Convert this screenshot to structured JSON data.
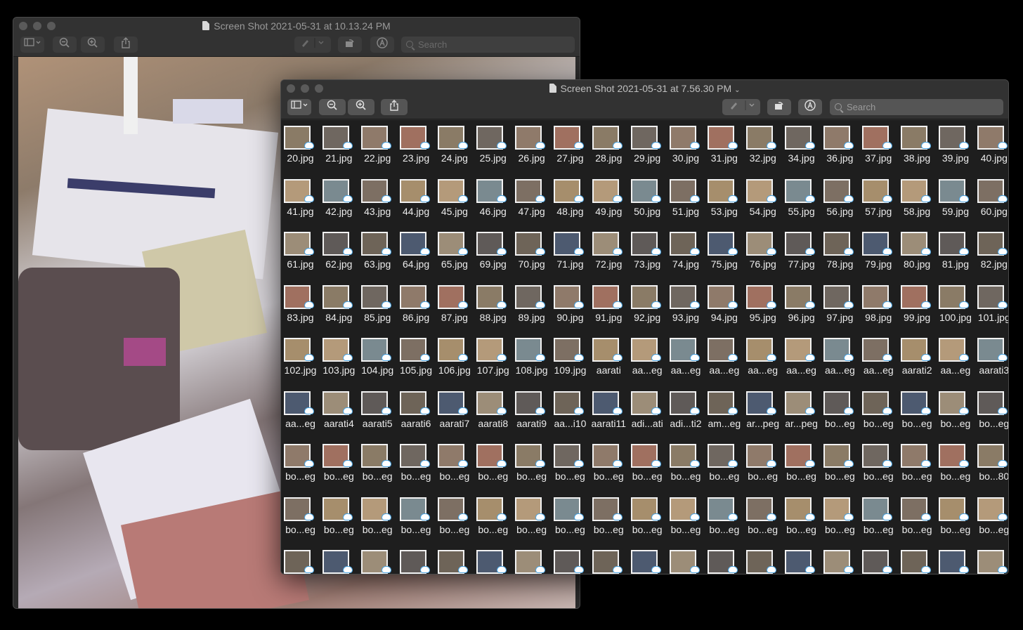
{
  "back_window": {
    "title": "Screen Shot 2021-05-31 at 10.13.24 PM",
    "search_placeholder": "Search"
  },
  "front_window": {
    "title": "Screen Shot 2021-05-31 at 7.56.30 PM",
    "title_chevron": "⌄",
    "search_placeholder": "Search",
    "toolbar": {
      "sidebar_icon": "sidebar-icon",
      "zoom_out_icon": "zoom-out-icon",
      "zoom_in_icon": "zoom-in-icon",
      "share_icon": "share-icon",
      "markup_icon": "markup-pen-icon",
      "rotate_icon": "rotate-icon",
      "annotate_icon": "annotate-circle-icon"
    },
    "thumbnail_rows": [
      [
        "20.jpg",
        "21.jpg",
        "22.jpg",
        "23.jpg",
        "24.jpg",
        "25.jpg",
        "26.jpg",
        "27.jpg",
        "28.jpg",
        "29.jpg",
        "30.jpg",
        "31.jpg",
        "32.jpg",
        "34.jpg",
        "36.jpg",
        "37.jpg",
        "38.jpg",
        "39.jpg",
        "40.jpg"
      ],
      [
        "41.jpg",
        "42.jpg",
        "43.jpg",
        "44.jpg",
        "45.jpg",
        "46.jpg",
        "47.jpg",
        "48.jpg",
        "49.jpg",
        "50.jpg",
        "51.jpg",
        "53.jpg",
        "54.jpg",
        "55.jpg",
        "56.jpg",
        "57.jpg",
        "58.jpg",
        "59.jpg",
        "60.jpg"
      ],
      [
        "61.jpg",
        "62.jpg",
        "63.jpg",
        "64.jpg",
        "65.jpg",
        "69.jpg",
        "70.jpg",
        "71.jpg",
        "72.jpg",
        "73.jpg",
        "74.jpg",
        "75.jpg",
        "76.jpg",
        "77.jpg",
        "78.jpg",
        "79.jpg",
        "80.jpg",
        "81.jpg",
        "82.jpg"
      ],
      [
        "83.jpg",
        "84.jpg",
        "85.jpg",
        "86.jpg",
        "87.jpg",
        "88.jpg",
        "89.jpg",
        "90.jpg",
        "91.jpg",
        "92.jpg",
        "93.jpg",
        "94.jpg",
        "95.jpg",
        "96.jpg",
        "97.jpg",
        "98.jpg",
        "99.jpg",
        "100.jpg",
        "101.jpg"
      ],
      [
        "102.jpg",
        "103.jpg",
        "104.jpg",
        "105.jpg",
        "106.jpg",
        "107.jpg",
        "108.jpg",
        "109.jpg",
        "aarati",
        "aa...eg",
        "aa...eg",
        "aa...eg",
        "aa...eg",
        "aa...eg",
        "aa...eg",
        "aa...eg",
        "aarati2",
        "aa...eg",
        "aarati3"
      ],
      [
        "aa...eg",
        "aarati4",
        "aarati5",
        "aarati6",
        "aarati7",
        "aarati8",
        "aarati9",
        "aa...i10",
        "aarati11",
        "adi...ati",
        "adi...ti2",
        "am...eg",
        "ar...peg",
        "ar...peg",
        "bo...eg",
        "bo...eg",
        "bo...eg",
        "bo...eg",
        "bo...eg"
      ],
      [
        "bo...eg",
        "bo...eg",
        "bo...eg",
        "bo...eg",
        "bo...eg",
        "bo...eg",
        "bo...eg",
        "bo...eg",
        "bo...eg",
        "bo...eg",
        "bo...eg",
        "bo...eg",
        "bo...eg",
        "bo...eg",
        "bo...eg",
        "bo...eg",
        "bo...eg",
        "bo...eg",
        "bo...80"
      ],
      [
        "bo...eg",
        "bo...eg",
        "bo...eg",
        "bo...eg",
        "bo...eg",
        "bo...eg",
        "bo...eg",
        "bo...eg",
        "bo...eg",
        "bo...eg",
        "bo...eg",
        "bo...eg",
        "bo...eg",
        "bo...eg",
        "bo...eg",
        "bo...eg",
        "bo...eg",
        "bo...eg",
        "bo...eg"
      ],
      [
        "",
        "",
        "",
        "",
        "",
        "",
        "",
        "",
        "",
        "",
        "",
        "",
        "",
        "",
        "",
        "",
        "",
        "",
        ""
      ]
    ]
  },
  "colors": {
    "desktop": "#000000",
    "window_chrome": "#323232",
    "grid_background": "#1e1e1e",
    "icloud_accent": "#4aa3e0"
  }
}
